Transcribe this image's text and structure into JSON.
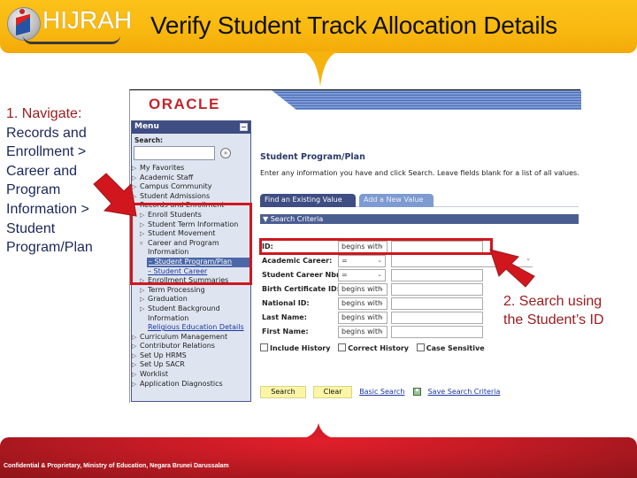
{
  "header": {
    "logo_text": "HIJRAH",
    "title": "Verify Student Track Allocation Details"
  },
  "annotations": {
    "step1_lead": "1. Navigate:",
    "step1_lines": [
      "Records and",
      "Enrollment >",
      "Career and",
      "Program",
      "Information >",
      "Student",
      "Program/Plan"
    ],
    "step2_lines": [
      "2. Search using",
      "the Student’s ID"
    ]
  },
  "app": {
    "vendor_logo": "ORACLE",
    "menu": {
      "title": "Menu",
      "search_label": "Search:",
      "search_value": "",
      "search_go_icon": "double-chevron-right",
      "items": [
        {
          "label": "My Favorites",
          "level": 0,
          "state": "collapsed"
        },
        {
          "label": "Academic Staff",
          "level": 0,
          "state": "collapsed"
        },
        {
          "label": "Campus Community",
          "level": 0,
          "state": "collapsed"
        },
        {
          "label": "Student Admissions",
          "level": 0,
          "state": "collapsed"
        },
        {
          "label": "Records and Enrollment",
          "level": 0,
          "state": "expanded"
        },
        {
          "label": "Enroll Students",
          "level": 1,
          "state": "collapsed"
        },
        {
          "label": "Student Term Information",
          "level": 1,
          "state": "collapsed"
        },
        {
          "label": "Student Movement",
          "level": 1,
          "state": "collapsed"
        },
        {
          "label": "Career and Program",
          "level": 1,
          "state": "expanded"
        },
        {
          "label": "Information",
          "level": 1,
          "state": "continuation"
        },
        {
          "label": "Student Program/Plan",
          "level": 2,
          "state": "selected"
        },
        {
          "label": "Student Career",
          "level": 2,
          "state": "link"
        },
        {
          "label": "Enrollment Summaries",
          "level": 1,
          "state": "collapsed"
        },
        {
          "label": "Term Processing",
          "level": 1,
          "state": "collapsed"
        },
        {
          "label": "Graduation",
          "level": 1,
          "state": "collapsed"
        },
        {
          "label": "Student Background",
          "level": 1,
          "state": "collapsed"
        },
        {
          "label": "Information",
          "level": 1,
          "state": "continuation"
        },
        {
          "label": "Religious Education Details",
          "level": 1,
          "state": "link"
        },
        {
          "label": "Curriculum Management",
          "level": 0,
          "state": "collapsed"
        },
        {
          "label": "Contributor Relations",
          "level": 0,
          "state": "collapsed"
        },
        {
          "label": "Set Up HRMS",
          "level": 0,
          "state": "collapsed"
        },
        {
          "label": "Set Up SACR",
          "level": 0,
          "state": "collapsed"
        },
        {
          "label": "Worklist",
          "level": 0,
          "state": "collapsed"
        },
        {
          "label": "Application Diagnostics",
          "level": 0,
          "state": "collapsed"
        }
      ]
    },
    "content": {
      "title": "Student Program/Plan",
      "instructions": "Enter any information you have and click Search. Leave fields blank for a list of all values.",
      "tabs": [
        {
          "label": "Find an Existing Value",
          "active": true
        },
        {
          "label": "Add a New Value",
          "active": false
        }
      ],
      "section_title": "Search Criteria",
      "fields": [
        {
          "label": "ID:",
          "operator": "begins with",
          "value": ""
        },
        {
          "label": "Academic Career:",
          "operator": "=",
          "value": ""
        },
        {
          "label": "Student Career Nbr:",
          "operator": "=",
          "value": ""
        },
        {
          "label": "Birth Certificate ID:",
          "operator": "begins with",
          "value": ""
        },
        {
          "label": "National ID:",
          "operator": "begins with",
          "value": ""
        },
        {
          "label": "Last Name:",
          "operator": "begins with",
          "value": ""
        },
        {
          "label": "First Name:",
          "operator": "begins with",
          "value": ""
        }
      ],
      "checkboxes": [
        {
          "label": "Include History",
          "checked": false
        },
        {
          "label": "Correct History",
          "checked": false
        },
        {
          "label": "Case Sensitive",
          "checked": false
        }
      ],
      "buttons": {
        "search": "Search",
        "clear": "Clear"
      },
      "links": {
        "basic_search": "Basic Search",
        "save_criteria": "Save Search Criteria"
      }
    }
  },
  "footer": {
    "text": "Confidential & Proprietary, Ministry of Education, Negara Brunei Darussalam"
  },
  "colors": {
    "banner": "#f9b80f",
    "title_text": "#111111",
    "annotation_red": "#9b1b1e",
    "annotation_navy": "#1b2759",
    "highlight_red": "#d1161e",
    "footer_red": "#c41b25",
    "ps_navy": "#3e4d82"
  }
}
